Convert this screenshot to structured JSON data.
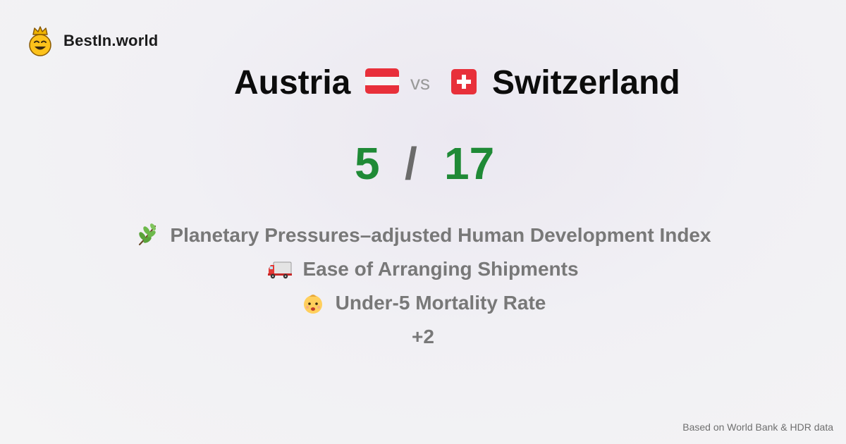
{
  "brand": {
    "name": "BestIn.world",
    "logo_icon": "crowned-smiley-icon"
  },
  "comparison": {
    "country_a": {
      "name": "Austria",
      "flag": "austria-flag-icon"
    },
    "vs_label": "vs",
    "country_b": {
      "name": "Switzerland",
      "flag": "switzerland-flag-icon"
    }
  },
  "score": {
    "a": "5",
    "separator": "/",
    "b": "17",
    "color": "#1f8a36"
  },
  "metrics": [
    {
      "icon": "herb-icon",
      "label": "Planetary Pressures–adjusted Human Development Index"
    },
    {
      "icon": "truck-icon",
      "label": "Ease of Arranging Shipments"
    },
    {
      "icon": "baby-icon",
      "label": "Under-5 Mortality Rate"
    }
  ],
  "more_label": "+2",
  "footer": {
    "source": "Based on World Bank & HDR data"
  }
}
